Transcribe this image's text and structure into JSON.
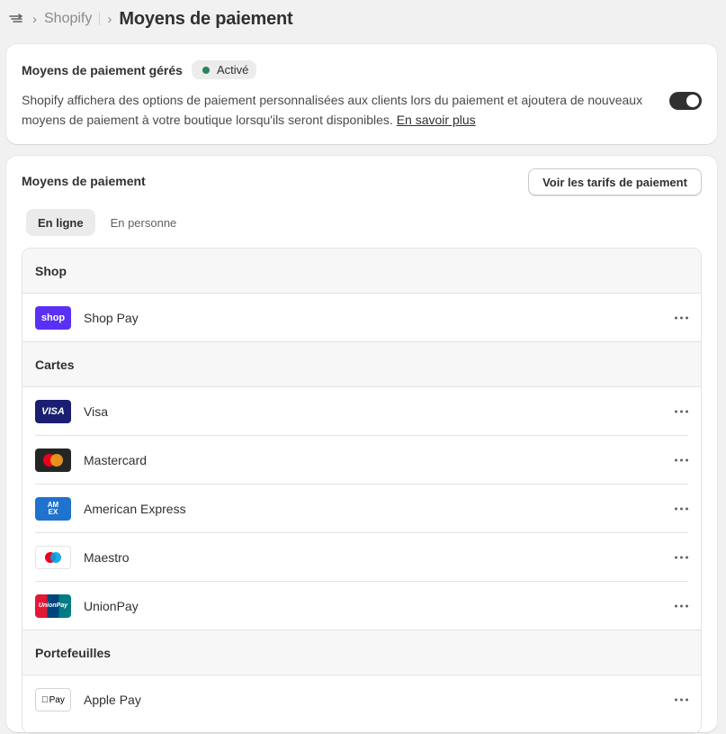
{
  "breadcrumb": {
    "app_icon": "settings-payments-icon",
    "shop": "Shopify",
    "title": "Moyens de paiement"
  },
  "managed": {
    "title": "Moyens de paiement gérés",
    "badge": "Activé",
    "badge_color": "#29845a",
    "description": "Shopify affichera des options de paiement personnalisées aux clients lors du paiement et ajoutera de nouveaux moyens de paiement à votre boutique lorsqu'ils seront disponibles.",
    "link": "En savoir plus",
    "toggle_on": true
  },
  "methods": {
    "title": "Moyens de paiement",
    "rates_button": "Voir les tarifs de paiement",
    "tabs": [
      "En ligne",
      "En personne"
    ],
    "active_tab": "En ligne",
    "sections": [
      {
        "name": "Shop",
        "items": [
          {
            "label": "Shop Pay",
            "logo": "shop-pay-logo",
            "logo_text": "shop"
          }
        ]
      },
      {
        "name": "Cartes",
        "items": [
          {
            "label": "Visa",
            "logo": "visa-logo",
            "logo_text": "VISA"
          },
          {
            "label": "Mastercard",
            "logo": "mastercard-logo"
          },
          {
            "label": "American Express",
            "logo": "amex-logo",
            "logo_text": "AM EX"
          },
          {
            "label": "Maestro",
            "logo": "maestro-logo"
          },
          {
            "label": "UnionPay",
            "logo": "unionpay-logo",
            "logo_text": "UnionPay"
          }
        ]
      },
      {
        "name": "Portefeuilles",
        "items": [
          {
            "label": "Apple Pay",
            "logo": "apple-pay-logo",
            "logo_text": "Pay"
          }
        ]
      }
    ]
  },
  "colors": {
    "page_bg": "#f1f1f1",
    "shop_pay": "#5a31f4",
    "visa": "#1a1f71",
    "mastercard_red": "#eb001b",
    "mastercard_orange": "#f79e1b",
    "amex": "#1f72cd",
    "maestro_red": "#eb001b",
    "maestro_blue": "#00a2e5"
  }
}
